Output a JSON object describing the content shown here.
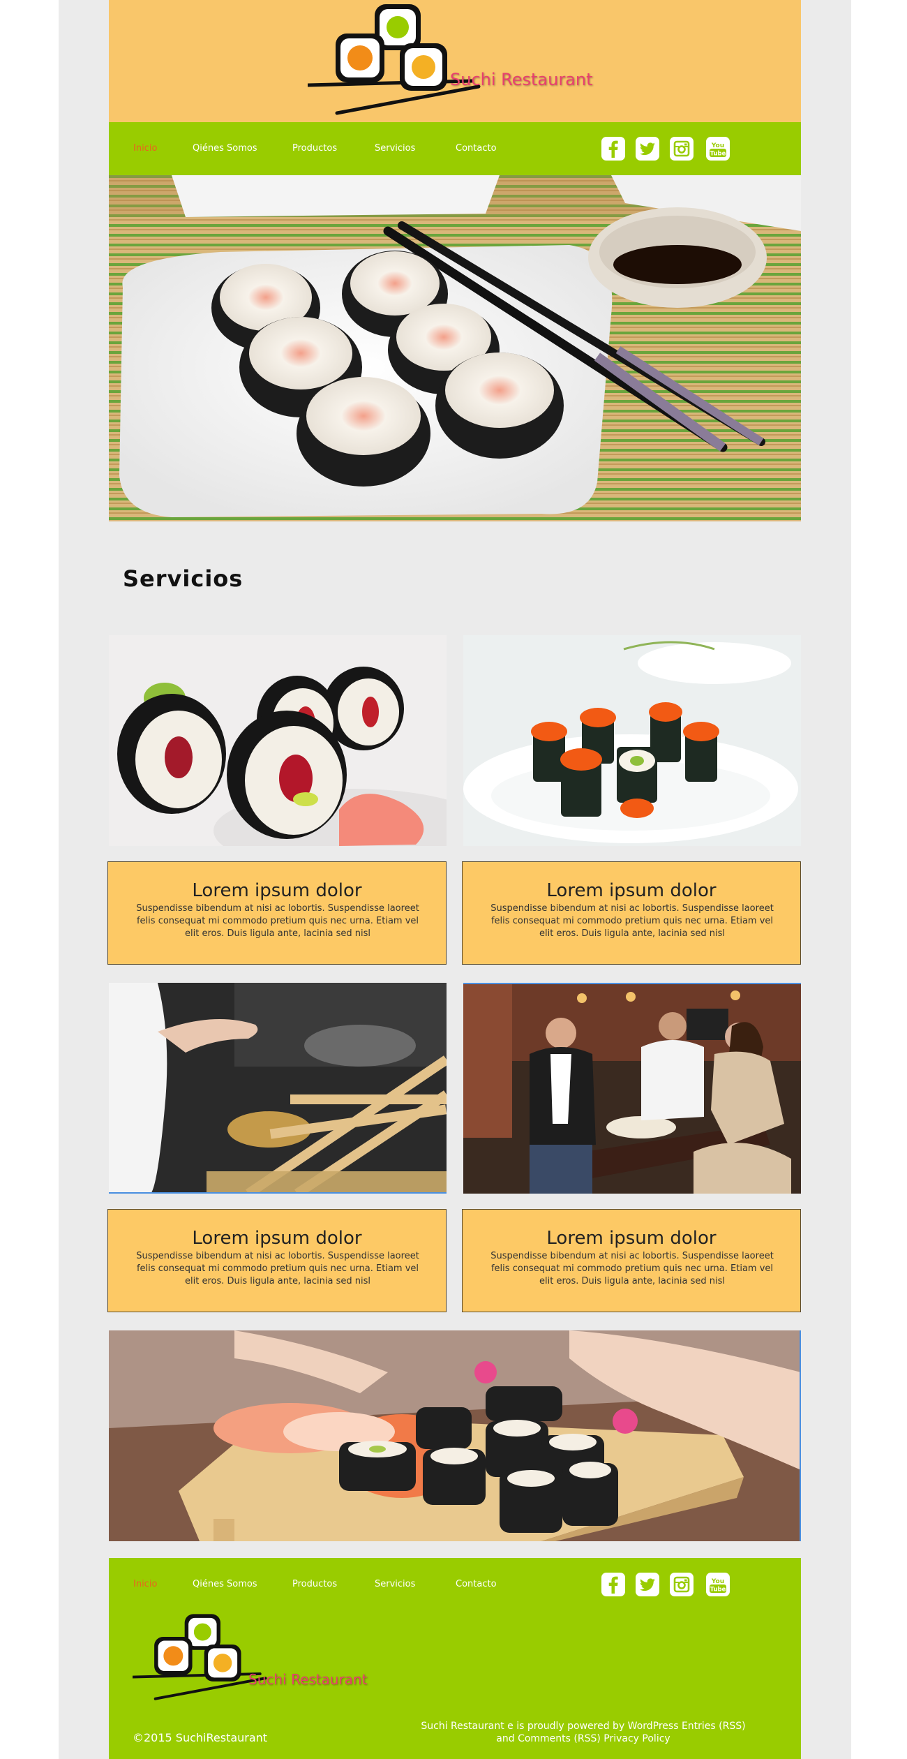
{
  "brand": {
    "name": "Suchi Restaurant"
  },
  "nav": {
    "items": [
      {
        "label": "Inicio",
        "active": true
      },
      {
        "label": "Qiénes Somos",
        "active": false
      },
      {
        "label": "Productos",
        "active": false
      },
      {
        "label": "Servicios",
        "active": false
      },
      {
        "label": "Contacto",
        "active": false
      }
    ]
  },
  "social": [
    "facebook-icon",
    "twitter-icon",
    "instagram-icon",
    "youtube-icon"
  ],
  "section": {
    "title": "Servicios"
  },
  "cards": [
    {
      "title": "Lorem ipsum dolor",
      "text": "Suspendisse bibendum at nisi ac lobortis. Suspendisse laoreet felis consequat mi commodo pretium quis nec urna. Etiam vel elit eros. Duis ligula ante, lacinia sed nisl"
    },
    {
      "title": "Lorem ipsum dolor",
      "text": "Suspendisse bibendum at nisi ac lobortis. Suspendisse laoreet felis consequat mi commodo pretium quis nec urna. Etiam vel elit eros. Duis ligula ante, lacinia sed nisl"
    },
    {
      "title": "Lorem ipsum dolor",
      "text": "Suspendisse bibendum at nisi ac lobortis. Suspendisse laoreet felis consequat mi commodo pretium quis nec urna. Etiam vel elit eros. Duis ligula ante, lacinia sed nisl"
    },
    {
      "title": "Lorem ipsum dolor",
      "text": "Suspendisse bibendum at nisi ac lobortis. Suspendisse laoreet felis consequat mi commodo pretium quis nec urna. Etiam vel elit eros. Duis ligula ante, lacinia sed nisl"
    }
  ],
  "footer": {
    "copyright": "©2015 SuchiRestaurant",
    "powered_line1": "Suchi Restaurant e is proudly powered by WordPress Entries (RSS)",
    "powered_line2": "and Comments (RSS) Privacy Policy"
  },
  "colors": {
    "header_bg": "#f9c66a",
    "nav_bg": "#99cc00",
    "active_nav": "#e8641e",
    "brand_text": "#e83f6f",
    "card_bg": "#fdc965",
    "page_bg": "#ebebeb"
  }
}
